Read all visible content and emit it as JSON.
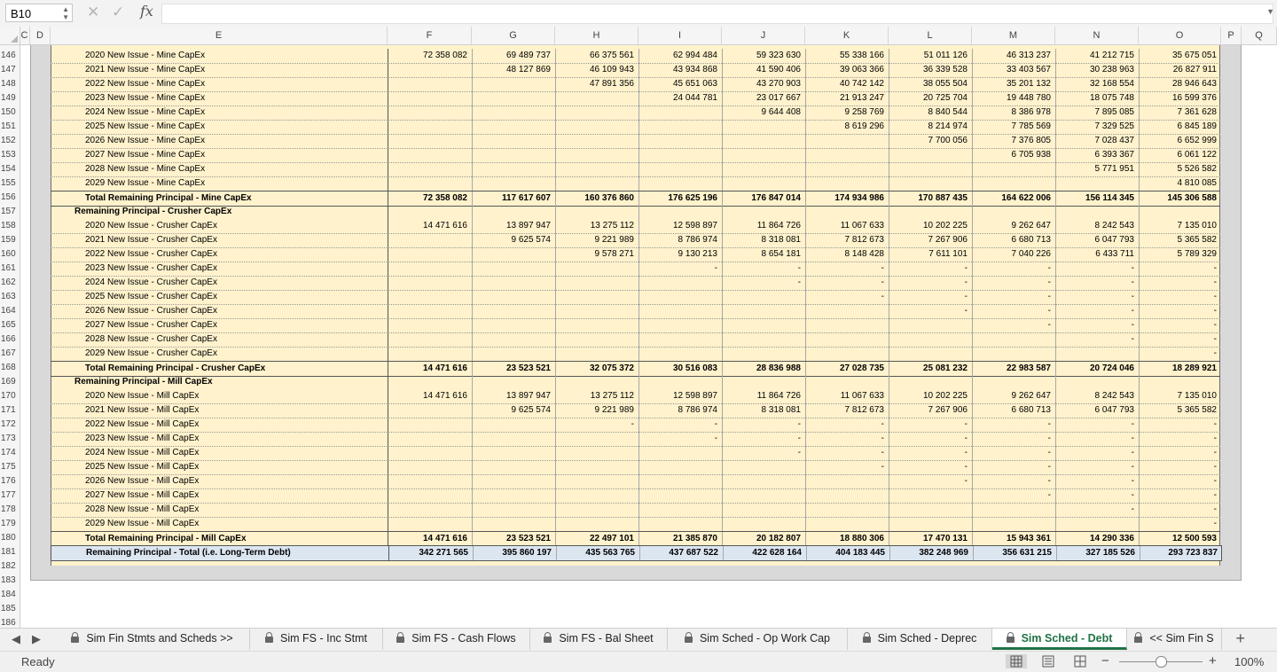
{
  "formula_bar": {
    "name_box": "B10",
    "formula": ""
  },
  "columns": [
    "C",
    "D",
    "E",
    "F",
    "G",
    "H",
    "I",
    "J",
    "K",
    "L",
    "M",
    "N",
    "O",
    "P",
    "Q"
  ],
  "rows": [
    {
      "n": "146",
      "type": "item",
      "label": "2020 New Issue - Mine CapEx",
      "v": [
        "72 358 082",
        "69 489 737",
        "66 375 561",
        "62 994 484",
        "59 323 630",
        "55 338 166",
        "51 011 126",
        "46 313 237",
        "41 212 715",
        "35 675 051"
      ]
    },
    {
      "n": "147",
      "type": "item",
      "label": "2021 New Issue - Mine CapEx",
      "v": [
        "",
        "48 127 869",
        "46 109 943",
        "43 934 868",
        "41 590 406",
        "39 063 366",
        "36 339 528",
        "33 403 567",
        "30 238 963",
        "26 827 911"
      ]
    },
    {
      "n": "148",
      "type": "item",
      "label": "2022 New Issue - Mine CapEx",
      "v": [
        "",
        "",
        "47 891 356",
        "45 651 063",
        "43 270 903",
        "40 742 142",
        "38 055 504",
        "35 201 132",
        "32 168 554",
        "28 946 643"
      ]
    },
    {
      "n": "149",
      "type": "item",
      "label": "2023 New Issue - Mine CapEx",
      "v": [
        "",
        "",
        "",
        "24 044 781",
        "23 017 667",
        "21 913 247",
        "20 725 704",
        "19 448 780",
        "18 075 748",
        "16 599 376"
      ]
    },
    {
      "n": "150",
      "type": "item",
      "label": "2024 New Issue - Mine CapEx",
      "v": [
        "",
        "",
        "",
        "",
        "9 644 408",
        "9 258 769",
        "8 840 544",
        "8 386 978",
        "7 895 085",
        "7 361 628"
      ]
    },
    {
      "n": "151",
      "type": "item",
      "label": "2025 New Issue - Mine CapEx",
      "v": [
        "",
        "",
        "",
        "",
        "",
        "8 619 296",
        "8 214 974",
        "7 785 569",
        "7 329 525",
        "6 845 189"
      ]
    },
    {
      "n": "152",
      "type": "item",
      "label": "2026 New Issue - Mine CapEx",
      "v": [
        "",
        "",
        "",
        "",
        "",
        "",
        "7 700 056",
        "7 376 805",
        "7 028 437",
        "6 652 999"
      ]
    },
    {
      "n": "153",
      "type": "item",
      "label": "2027 New Issue - Mine CapEx",
      "v": [
        "",
        "",
        "",
        "",
        "",
        "",
        "",
        "6 705 938",
        "6 393 367",
        "6 061 122"
      ]
    },
    {
      "n": "154",
      "type": "item",
      "label": "2028 New Issue - Mine CapEx",
      "v": [
        "",
        "",
        "",
        "",
        "",
        "",
        "",
        "",
        "5 771 951",
        "5 526 582"
      ]
    },
    {
      "n": "155",
      "type": "item",
      "label": "2029 New Issue - Mine CapEx",
      "v": [
        "",
        "",
        "",
        "",
        "",
        "",
        "",
        "",
        "",
        "4 810 085"
      ]
    },
    {
      "n": "156",
      "type": "total",
      "label": "Total Remaining Principal - Mine CapEx",
      "v": [
        "72 358 082",
        "117 617 607",
        "160 376 860",
        "176 625 196",
        "176 847 014",
        "174 934 986",
        "170 887 435",
        "164 622 006",
        "156 114 345",
        "145 306 588"
      ]
    },
    {
      "n": "157",
      "type": "head",
      "label": "Remaining Principal - Crusher CapEx",
      "v": [
        "",
        "",
        "",
        "",
        "",
        "",
        "",
        "",
        "",
        ""
      ]
    },
    {
      "n": "158",
      "type": "item",
      "label": "2020 New Issue - Crusher CapEx",
      "v": [
        "14 471 616",
        "13 897 947",
        "13 275 112",
        "12 598 897",
        "11 864 726",
        "11 067 633",
        "10 202 225",
        "9 262 647",
        "8 242 543",
        "7 135 010"
      ]
    },
    {
      "n": "159",
      "type": "item",
      "label": "2021 New Issue - Crusher CapEx",
      "v": [
        "",
        "9 625 574",
        "9 221 989",
        "8 786 974",
        "8 318 081",
        "7 812 673",
        "7 267 906",
        "6 680 713",
        "6 047 793",
        "5 365 582"
      ]
    },
    {
      "n": "160",
      "type": "item",
      "label": "2022 New Issue - Crusher CapEx",
      "v": [
        "",
        "",
        "9 578 271",
        "9 130 213",
        "8 654 181",
        "8 148 428",
        "7 611 101",
        "7 040 226",
        "6 433 711",
        "5 789 329"
      ]
    },
    {
      "n": "161",
      "type": "item",
      "label": "2023 New Issue - Crusher CapEx",
      "v": [
        "",
        "",
        "",
        "-",
        "-",
        "-",
        "-",
        "-",
        "-",
        "-"
      ]
    },
    {
      "n": "162",
      "type": "item",
      "label": "2024 New Issue - Crusher CapEx",
      "v": [
        "",
        "",
        "",
        "",
        "-",
        "-",
        "-",
        "-",
        "-",
        "-"
      ]
    },
    {
      "n": "163",
      "type": "item",
      "label": "2025 New Issue - Crusher CapEx",
      "v": [
        "",
        "",
        "",
        "",
        "",
        "-",
        "-",
        "-",
        "-",
        "-"
      ]
    },
    {
      "n": "164",
      "type": "item",
      "label": "2026 New Issue - Crusher CapEx",
      "v": [
        "",
        "",
        "",
        "",
        "",
        "",
        "-",
        "-",
        "-",
        "-"
      ]
    },
    {
      "n": "165",
      "type": "item",
      "label": "2027 New Issue - Crusher CapEx",
      "v": [
        "",
        "",
        "",
        "",
        "",
        "",
        "",
        "-",
        "-",
        "-"
      ]
    },
    {
      "n": "166",
      "type": "item",
      "label": "2028 New Issue - Crusher CapEx",
      "v": [
        "",
        "",
        "",
        "",
        "",
        "",
        "",
        "",
        "-",
        "-"
      ]
    },
    {
      "n": "167",
      "type": "item",
      "label": "2029 New Issue - Crusher CapEx",
      "v": [
        "",
        "",
        "",
        "",
        "",
        "",
        "",
        "",
        "",
        "-"
      ]
    },
    {
      "n": "168",
      "type": "total",
      "label": "Total Remaining Principal - Crusher CapEx",
      "v": [
        "14 471 616",
        "23 523 521",
        "32 075 372",
        "30 516 083",
        "28 836 988",
        "27 028 735",
        "25 081 232",
        "22 983 587",
        "20 724 046",
        "18 289 921"
      ]
    },
    {
      "n": "169",
      "type": "head",
      "label": "Remaining Principal - Mill CapEx",
      "v": [
        "",
        "",
        "",
        "",
        "",
        "",
        "",
        "",
        "",
        ""
      ]
    },
    {
      "n": "170",
      "type": "item",
      "label": "2020 New Issue - Mill CapEx",
      "v": [
        "14 471 616",
        "13 897 947",
        "13 275 112",
        "12 598 897",
        "11 864 726",
        "11 067 633",
        "10 202 225",
        "9 262 647",
        "8 242 543",
        "7 135 010"
      ]
    },
    {
      "n": "171",
      "type": "item",
      "label": "2021 New Issue - Mill CapEx",
      "v": [
        "",
        "9 625 574",
        "9 221 989",
        "8 786 974",
        "8 318 081",
        "7 812 673",
        "7 267 906",
        "6 680 713",
        "6 047 793",
        "5 365 582"
      ]
    },
    {
      "n": "172",
      "type": "item",
      "label": "2022 New Issue - Mill CapEx",
      "v": [
        "",
        "",
        "-",
        "-",
        "-",
        "-",
        "-",
        "-",
        "-",
        "-"
      ]
    },
    {
      "n": "173",
      "type": "item",
      "label": "2023 New Issue - Mill CapEx",
      "v": [
        "",
        "",
        "",
        "-",
        "-",
        "-",
        "-",
        "-",
        "-",
        "-"
      ]
    },
    {
      "n": "174",
      "type": "item",
      "label": "2024 New Issue - Mill CapEx",
      "v": [
        "",
        "",
        "",
        "",
        "-",
        "-",
        "-",
        "-",
        "-",
        "-"
      ]
    },
    {
      "n": "175",
      "type": "item",
      "label": "2025 New Issue - Mill CapEx",
      "v": [
        "",
        "",
        "",
        "",
        "",
        "-",
        "-",
        "-",
        "-",
        "-"
      ]
    },
    {
      "n": "176",
      "type": "item",
      "label": "2026 New Issue - Mill CapEx",
      "v": [
        "",
        "",
        "",
        "",
        "",
        "",
        "-",
        "-",
        "-",
        "-"
      ]
    },
    {
      "n": "177",
      "type": "item",
      "label": "2027 New Issue - Mill CapEx",
      "v": [
        "",
        "",
        "",
        "",
        "",
        "",
        "",
        "-",
        "-",
        "-"
      ]
    },
    {
      "n": "178",
      "type": "item",
      "label": "2028 New Issue - Mill CapEx",
      "v": [
        "",
        "",
        "",
        "",
        "",
        "",
        "",
        "",
        "-",
        "-"
      ]
    },
    {
      "n": "179",
      "type": "item",
      "label": "2029 New Issue - Mill CapEx",
      "v": [
        "",
        "",
        "",
        "",
        "",
        "",
        "",
        "",
        "",
        "-"
      ]
    },
    {
      "n": "180",
      "type": "total",
      "label": "Total Remaining Principal - Mill CapEx",
      "v": [
        "14 471 616",
        "23 523 521",
        "22 497 101",
        "21 385 870",
        "20 182 807",
        "18 880 306",
        "17 470 131",
        "15 943 361",
        "14 290 336",
        "12 500 593"
      ]
    },
    {
      "n": "181",
      "type": "grand",
      "label": "Remaining Principal - Total (i.e. Long-Term Debt)",
      "v": [
        "342 271 565",
        "395 860 197",
        "435 563 765",
        "437 687 522",
        "422 628 164",
        "404 183 445",
        "382 248 969",
        "356 631 215",
        "327 185 526",
        "293 723 837"
      ]
    },
    {
      "n": "182",
      "type": "blank",
      "label": "",
      "v": []
    },
    {
      "n": "183",
      "type": "blank",
      "label": "",
      "v": []
    },
    {
      "n": "184",
      "type": "blank",
      "label": "",
      "v": []
    },
    {
      "n": "185",
      "type": "blank",
      "label": "",
      "v": []
    },
    {
      "n": "186",
      "type": "blank",
      "label": "",
      "v": []
    }
  ],
  "tabs": [
    {
      "label": "Sim Fin Stmts and Scheds >>",
      "locked": true,
      "active": false
    },
    {
      "label": "Sim FS - Inc Stmt",
      "locked": true,
      "active": false
    },
    {
      "label": "Sim FS - Cash Flows",
      "locked": true,
      "active": false
    },
    {
      "label": "Sim FS - Bal Sheet",
      "locked": true,
      "active": false
    },
    {
      "label": "Sim Sched - Op Work Cap",
      "locked": true,
      "active": false
    },
    {
      "label": "Sim Sched - Deprec",
      "locked": true,
      "active": false
    },
    {
      "label": "Sim Sched - Debt",
      "locked": true,
      "active": true
    },
    {
      "label": "<< Sim Fin S",
      "locked": true,
      "active": false
    }
  ],
  "status": {
    "text": "Ready",
    "zoom": "100%"
  },
  "colors": {
    "sheet_bg": "#fff2cc",
    "total_row_bg": "#dce6f1",
    "active_tab": "#217346"
  }
}
